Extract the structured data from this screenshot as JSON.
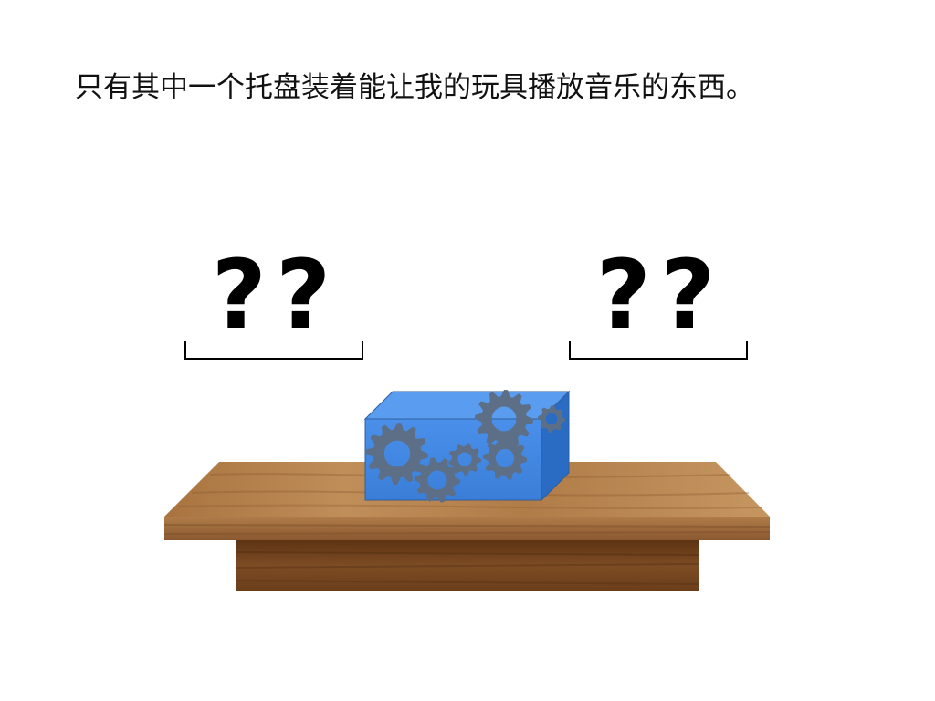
{
  "caption": "只有其中一个托盘装着能让我的玩具播放音乐的东西。",
  "trays": [
    {
      "marks": "??"
    },
    {
      "marks": "??"
    }
  ],
  "colors": {
    "box_front": "#3f86e0",
    "box_top": "#5a9cf0",
    "box_side": "#2a6cc4",
    "gear": "#5c6f87",
    "wood_top": "#b98752",
    "wood_edge": "#8f5d30",
    "wood_base": "#7a4a22"
  },
  "icons": [
    "question-mark-icon",
    "gear-icon"
  ]
}
